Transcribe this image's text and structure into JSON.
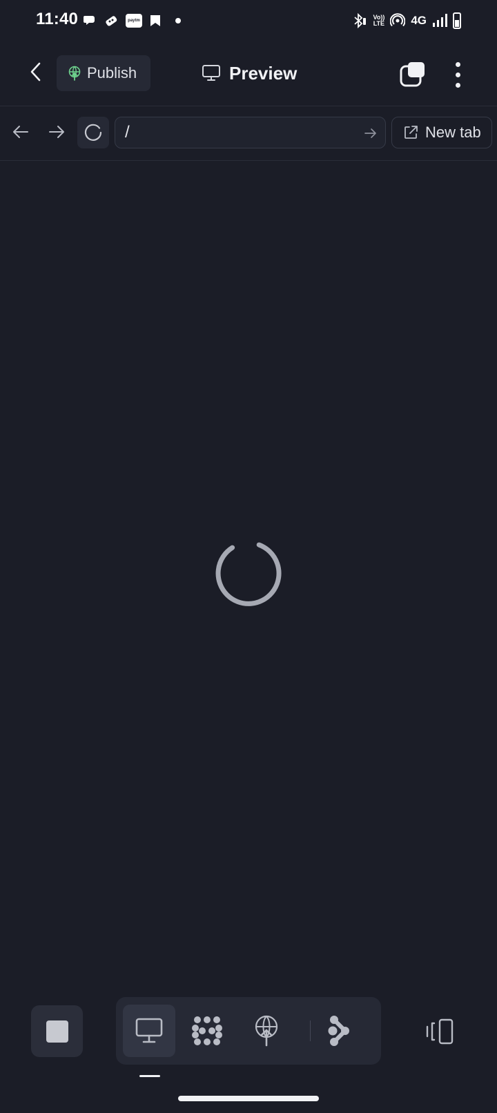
{
  "status_bar": {
    "time": "11:40",
    "paytm_text": "paytm",
    "volte_top": "Vo))",
    "volte_bottom": "LTE",
    "network": "4G"
  },
  "app_bar": {
    "publish_label": "Publish",
    "title": "Preview"
  },
  "browser": {
    "url_value": "/",
    "new_tab_label": "New tab"
  },
  "colors": {
    "background": "#1b1d27",
    "publish_icon": "#6fd38e",
    "spinner": "#a6a9b3",
    "icon": "#b9bcc5"
  },
  "icons": {
    "back": "chevron-left-icon",
    "publish": "globe-upload-icon",
    "preview": "monitor-icon",
    "tabs": "tabs-icon",
    "more": "more-vertical-icon",
    "nav_back": "arrow-left-icon",
    "nav_forward": "arrow-right-icon",
    "reload": "reload-icon",
    "go": "arrow-right-icon",
    "new_tab": "external-link-icon",
    "stop": "stop-icon",
    "webview": "monitor-icon",
    "workflow": "dots-grid-icon",
    "deploy": "globe-upload-icon",
    "share": "share-nodes-icon",
    "device_preview": "device-icon"
  }
}
